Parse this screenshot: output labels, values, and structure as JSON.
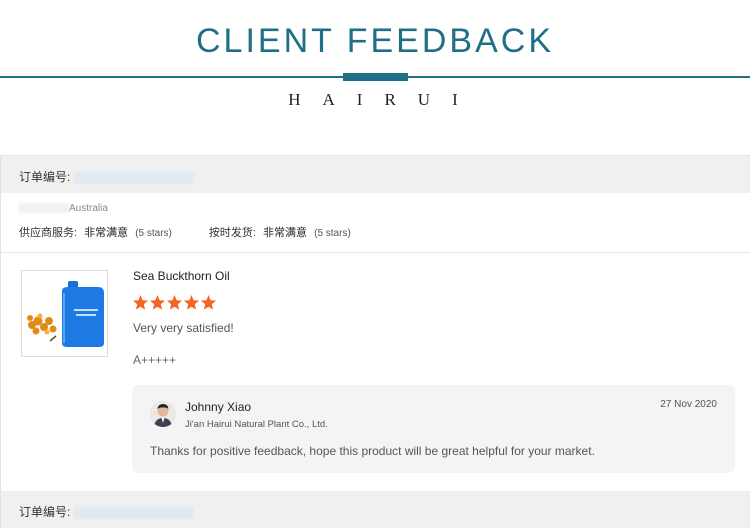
{
  "header": {
    "title": "CLIENT FEEDBACK",
    "subtitle": "HAIRUI",
    "accent_color": "#1f6f86"
  },
  "orders": [
    {
      "order_label": "订单编号:"
    },
    {
      "order_label": "订单编号:"
    }
  ],
  "buyer": {
    "country": "Australia"
  },
  "ratings": [
    {
      "label": "供应商服务:",
      "value": "非常满意",
      "note": "(5 stars)"
    },
    {
      "label": "按时发货:",
      "value": "非常满意",
      "note": "(5 stars)"
    }
  ],
  "product": {
    "name": "Sea Buckthorn Oil",
    "image_icon": "product-bottle-icon",
    "stars": 5,
    "star_color": "#f26522",
    "review": "Very very satisfied!",
    "review_extra": "A+++++"
  },
  "reply": {
    "name": "Johnny Xiao",
    "company": "Ji'an Hairui Natural Plant Co., Ltd.",
    "date": "27 Nov 2020",
    "message": "Thanks for positive feedback, hope this product will be great helpful for your market."
  }
}
